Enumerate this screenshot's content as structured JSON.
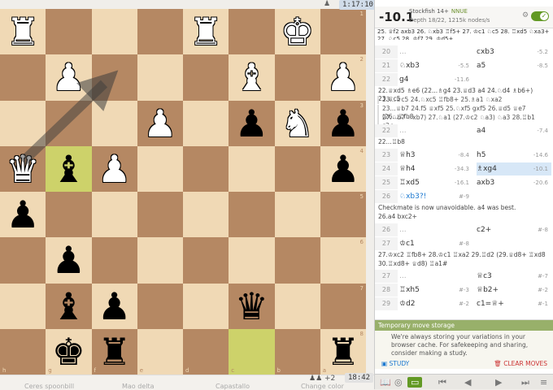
{
  "clocks": {
    "top": "1:17:10",
    "bottom": "18:42"
  },
  "material": "+2",
  "board": {
    "files": [
      "h",
      "g",
      "f",
      "e",
      "d",
      "c",
      "b",
      "a"
    ],
    "ranks": [
      "1",
      "2",
      "3",
      "4",
      "5",
      "6",
      "7",
      "8"
    ],
    "rows": [
      [
        "wR",
        "",
        "",
        "",
        "wR",
        "",
        "bK-w",
        ""
      ],
      [
        "",
        "wP",
        "",
        "",
        "",
        "wB",
        "",
        "wP"
      ],
      [
        "",
        "",
        "",
        "wP",
        "",
        "bP",
        "wN",
        "bP"
      ],
      [
        "wQ",
        "bB",
        "wP",
        "",
        "",
        "",
        "",
        "bP"
      ],
      [
        "bP",
        "",
        "",
        "",
        "",
        "",
        "",
        ""
      ],
      [
        "",
        "bP",
        "",
        "",
        "",
        "",
        "",
        ""
      ],
      [
        "",
        "bB",
        "bP",
        "",
        "",
        "bQ",
        "",
        ""
      ],
      [
        "",
        "bK",
        "bR",
        "",
        "",
        "",
        "",
        "bR"
      ]
    ],
    "highlights": [
      [
        3,
        1
      ],
      [
        7,
        5
      ]
    ]
  },
  "ceval": {
    "score": "-10.1",
    "engine": "Stockfish 14+",
    "nnue": "NNUE",
    "depth": "Depth 18/22, 1215k nodes/s"
  },
  "pv": "25. ♕f2 axb3 26. ♘xb3 ♖f5+ 27. ♔c1 ♘c5 28. ♖xd5 ♘xa3+ 29. ♔",
  "pv_cut": "27. ♘c5 28. ♔f7 29. ♔d5+",
  "moves": [
    {
      "num": "20",
      "w": "...",
      "wev": "",
      "b": "cxb3",
      "bev": "-5.2"
    },
    {
      "num": "21",
      "w": "♘xb3",
      "wev": "-5.5",
      "b": "a5",
      "bev": "-8.5"
    },
    {
      "num": "22",
      "w": "g4",
      "wev": "-11.6",
      "b": "",
      "bev": ""
    }
  ],
  "var1": "22.♕xd5 ♗e6 (22...♗g4 23.♕d3 a4 24.♘d4 ♗b6+) 23.♕c5",
  "var2": "23...♕c5 24.♘xc5 ♖fb8+ 25.♗a1 ♘xa2",
  "var3": "23...♕b7 24.f5 ♕xf5 25.♘xf5 gxf5 26.♕d5 ♕e7 (26...♖fb8",
  "var4": "27.♘b7 ♘xb7) 27.♘a1 (27.♔c2 ♘a3) ♘a3 28.♖b1 c2+",
  "move22b": {
    "num": "22",
    "w": "...",
    "b": "a4",
    "bev": "-7.4"
  },
  "var5": "22...♖b8",
  "moves2": [
    {
      "num": "23",
      "w": "♕h3",
      "wev": "-8.4",
      "b": "h5",
      "bev": "-14.6"
    },
    {
      "num": "24",
      "w": "♕h4",
      "wev": "-34.3",
      "b": "♗xg4",
      "bev": "-10.1"
    },
    {
      "num": "25",
      "w": "♖xd5",
      "wev": "-16.1",
      "b": "axb3",
      "bev": "-20.6"
    },
    {
      "num": "26",
      "w": "♘xb3?!",
      "wev": "#-9",
      "b": "",
      "bev": ""
    }
  ],
  "comment": "Checkmate is now unavoidable. a4 was best.",
  "var6": "26.a4 bxc2+",
  "moves3": [
    {
      "num": "26",
      "w": "...",
      "wev": "",
      "b": "c2+",
      "bev": "#-8"
    },
    {
      "num": "27",
      "w": "♔c1",
      "wev": "#-8",
      "b": "",
      "bev": ""
    }
  ],
  "var7": "27.♔xc2 ♖fb8+ 28.♔c1 ♖xa2 29.♖d2 (29.♕d8+ ♖xd8",
  "var8": "30.♖xd8+ ♕d8) ♖a1#",
  "moves4": [
    {
      "num": "27",
      "w": "...",
      "wev": "",
      "b": "♕c3",
      "bev": "#-7"
    },
    {
      "num": "28",
      "w": "♖xh5",
      "wev": "#-3",
      "b": "♕b2+",
      "bev": "#-2"
    },
    {
      "num": "29",
      "w": "♔d2",
      "wev": "#-2",
      "b": "c1=♕+",
      "bev": "#-1"
    }
  ],
  "storage": {
    "title": "Temporary move storage",
    "text": "We're always storing your variations in your browser cache. For safekeeping and sharing, consider making a study.",
    "study": "STUDY",
    "clear": "CLEAR MOVES"
  },
  "bottom_labels": [
    "Ceres spoonbill",
    "Mao delta",
    "Capastallo",
    "Change color"
  ],
  "colors": {
    "light": "#f0d9b5",
    "dark": "#b58863",
    "accent": "#629924",
    "highlight": "#cdd26a"
  }
}
